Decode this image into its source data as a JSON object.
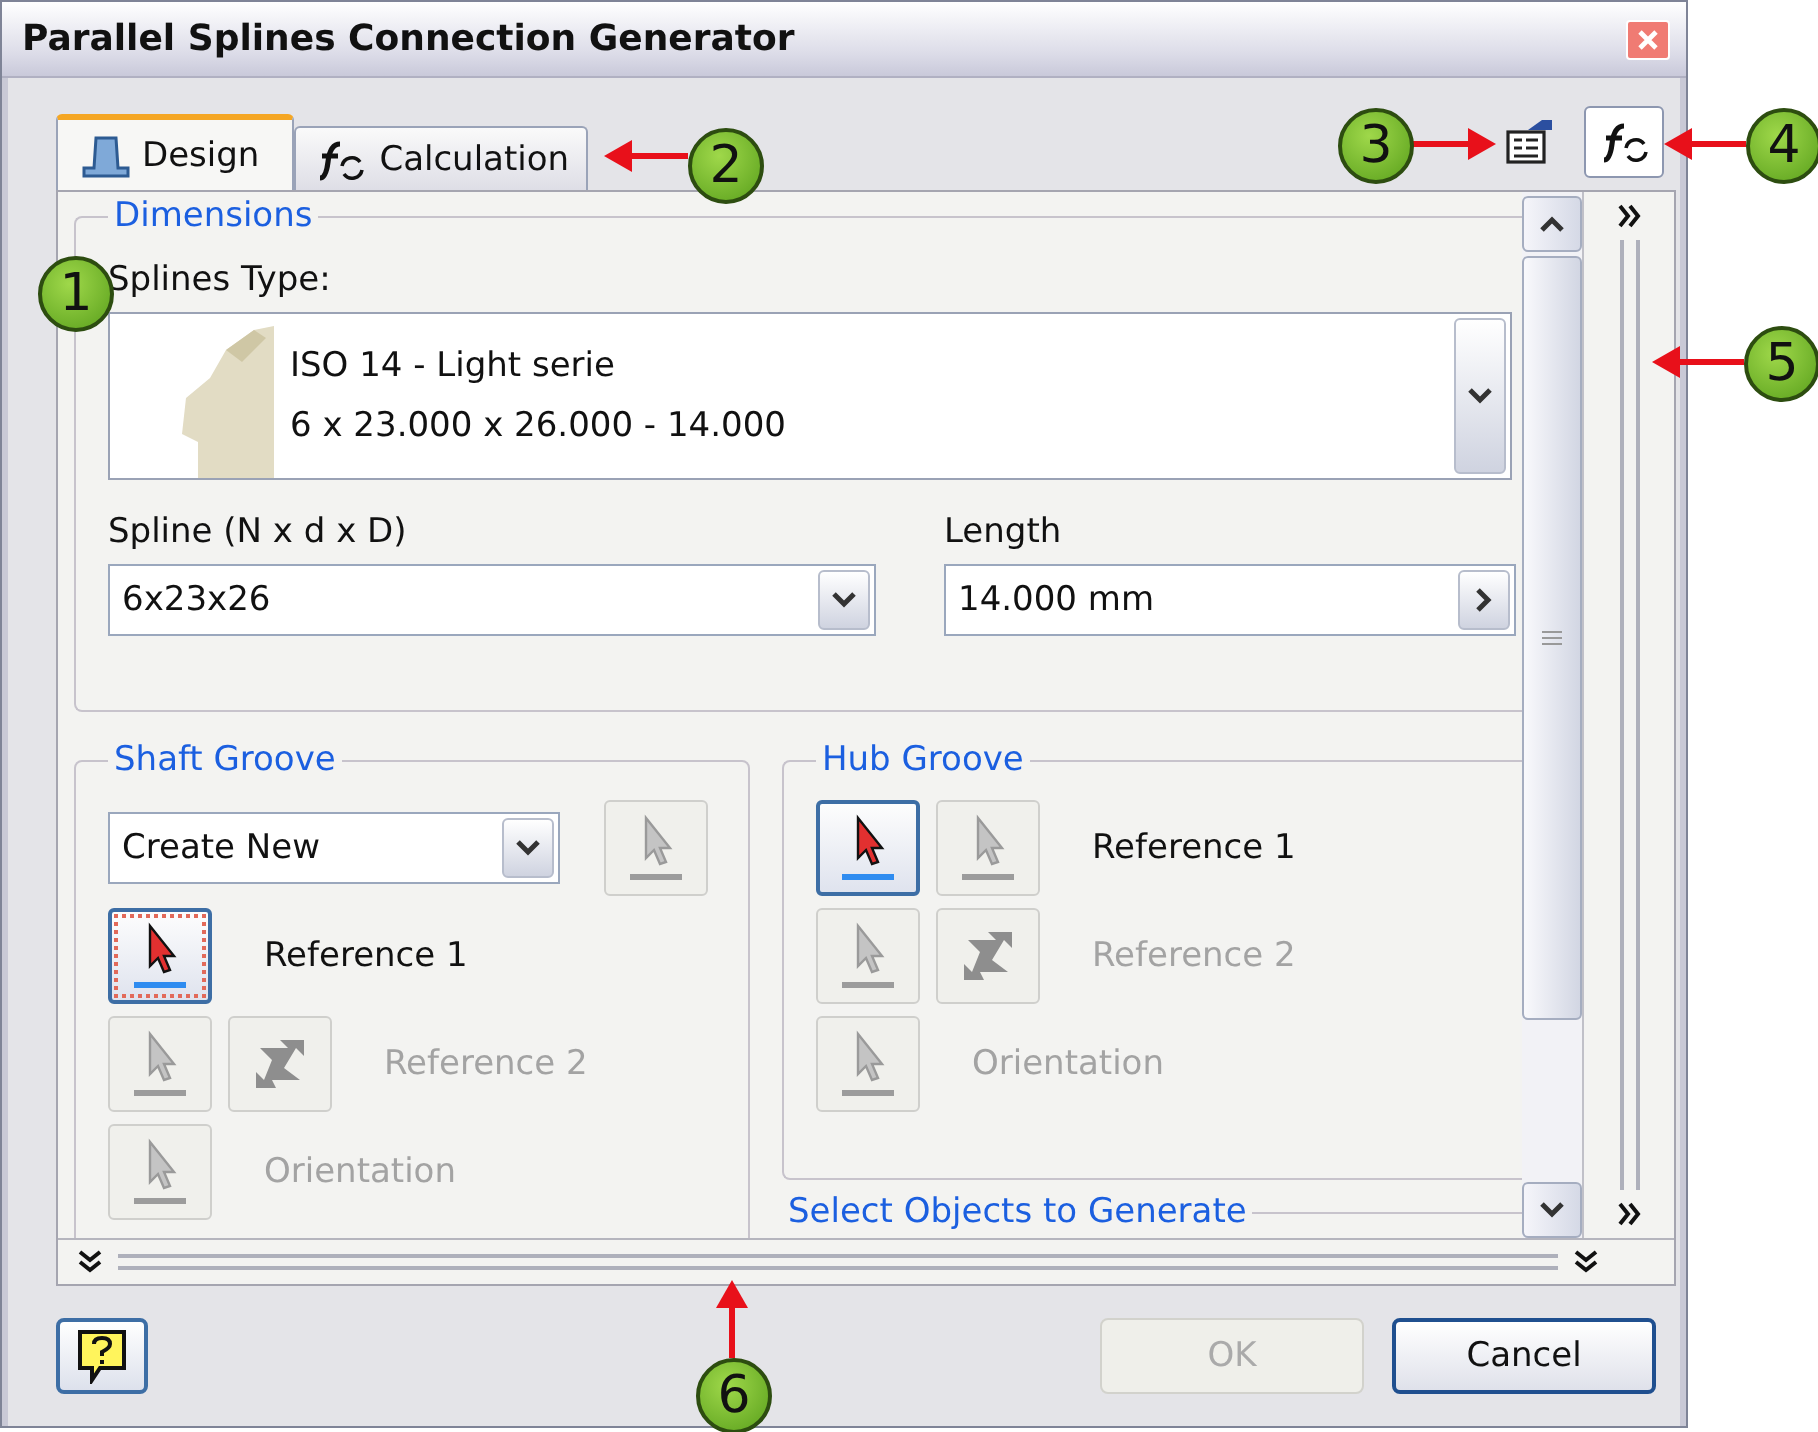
{
  "window": {
    "title": "Parallel Splines Connection Generator"
  },
  "tabs": [
    {
      "label": "Design",
      "kind": "design",
      "selected": true
    },
    {
      "label": "Calculation",
      "kind": "calculation",
      "selected": false
    }
  ],
  "dimensions": {
    "legend": "Dimensions",
    "splines_type_label": "Splines Type:",
    "splines_type": {
      "name": "ISO 14 - Light serie",
      "size": "6 x 23.000 x 26.000 - 14.000"
    },
    "spline": {
      "label": "Spline (N x d x D)",
      "value": "6x23x26"
    },
    "length": {
      "label": "Length",
      "value": "14.000 mm"
    }
  },
  "shaft_groove": {
    "legend": "Shaft Groove",
    "option": "Create New",
    "rows": [
      {
        "label": "Reference 1",
        "disabled": false,
        "buttons": [
          {
            "kind": "select",
            "disabled": false,
            "focused": true
          }
        ]
      },
      {
        "label": "Reference 2",
        "disabled": true,
        "buttons": [
          {
            "kind": "select",
            "disabled": true,
            "focused": false
          },
          {
            "kind": "flip",
            "disabled": true,
            "focused": false
          }
        ]
      },
      {
        "label": "Orientation",
        "disabled": true,
        "buttons": [
          {
            "kind": "select",
            "disabled": true,
            "focused": false
          }
        ]
      }
    ]
  },
  "hub_groove": {
    "legend": "Hub Groove",
    "rows": [
      {
        "label": "Reference 1",
        "disabled": false,
        "buttons": [
          {
            "kind": "select",
            "disabled": false,
            "focused": false
          },
          {
            "kind": "select",
            "disabled": true,
            "focused": false
          }
        ]
      },
      {
        "label": "Reference 2",
        "disabled": true,
        "buttons": [
          {
            "kind": "select",
            "disabled": true,
            "focused": false
          },
          {
            "kind": "flip",
            "disabled": true,
            "focused": false
          }
        ]
      },
      {
        "label": "Orientation",
        "disabled": true,
        "buttons": [
          {
            "kind": "select",
            "disabled": true,
            "focused": false
          }
        ]
      }
    ]
  },
  "next_section": {
    "legend": "Select Objects to Generate"
  },
  "buttons": [
    {
      "label": "OK",
      "disabled": true
    },
    {
      "label": "Cancel",
      "disabled": false
    }
  ],
  "callouts": [
    {
      "number": "1"
    },
    {
      "number": "2"
    },
    {
      "number": "3"
    },
    {
      "number": "4"
    },
    {
      "number": "5"
    },
    {
      "number": "6"
    }
  ]
}
